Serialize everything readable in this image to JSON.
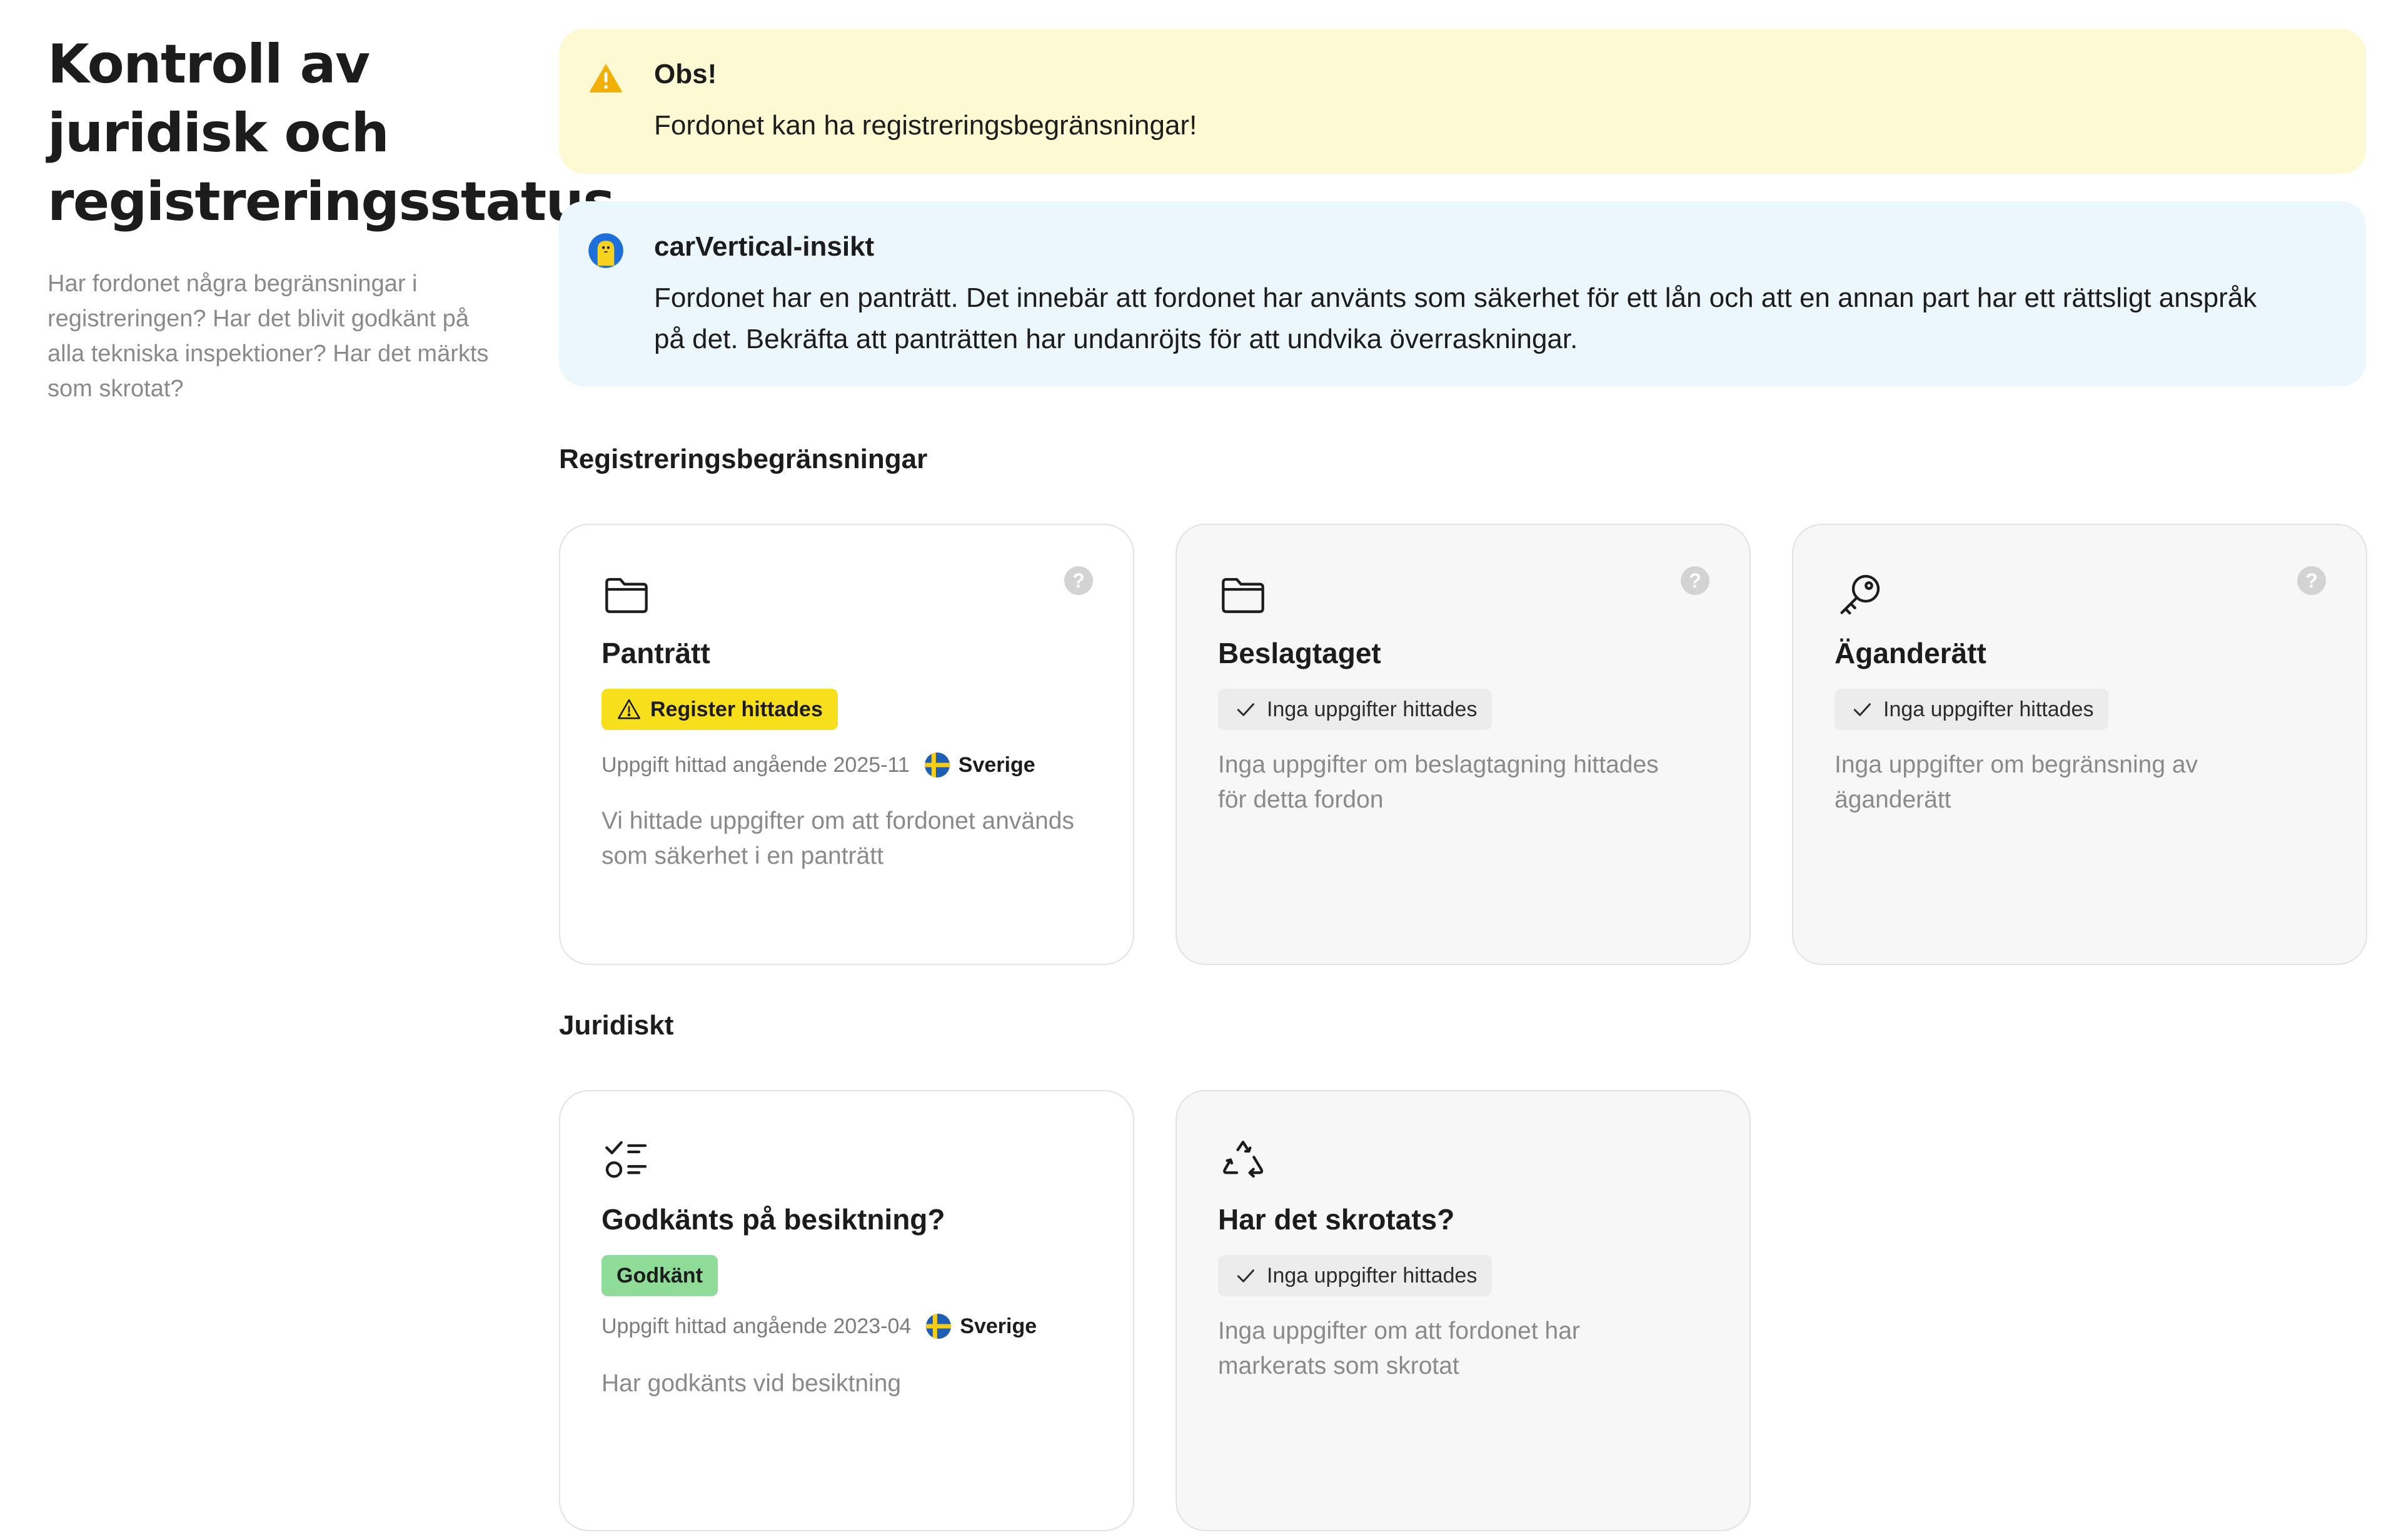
{
  "header": {
    "title": "Kontroll av juridisk och registreringsstatus",
    "description": "Har fordonet några begränsningar i registreringen? Har det blivit godkänt på alla tekniska inspektioner? Har det märkts som skrotat?"
  },
  "alerts": {
    "warning": {
      "title": "Obs!",
      "body": "Fordonet kan ha registreringsbegränsningar!",
      "icon": "warning-triangle-icon",
      "color": "#fdf9d2"
    },
    "insight": {
      "title": "carVertical-insikt",
      "body": "Fordonet har en panträtt. Det innebär att fordonet har använts som säkerhet för ett lån och att en annan part har ett rättsligt anspråk på det. Bekräfta att panträtten har undanröjts för att undvika överraskningar.",
      "icon": "carvertical-mascot-icon",
      "color": "#ecf6fd"
    }
  },
  "sections": {
    "registration": {
      "title": "Registreringsbegränsningar",
      "cards": {
        "pledge": {
          "icon": "folder-icon",
          "title": "Panträtt",
          "badge": "Register hittades",
          "badge_color": "#f8df1c",
          "meta": "Uppgift hittad angående 2025-11",
          "country": "Sverige",
          "description": "Vi hittade uppgifter om att fordonet används som säkerhet i en panträtt"
        },
        "seized": {
          "icon": "folder-icon",
          "title": "Beslagtaget",
          "badge": "Inga uppgifter hittades",
          "description": "Inga uppgifter om beslagtagning hittades för detta fordon"
        },
        "ownership": {
          "icon": "key-icon",
          "title": "Äganderätt",
          "badge": "Inga uppgifter hittades",
          "description": "Inga uppgifter om begränsning av äganderätt"
        }
      }
    },
    "legal": {
      "title": "Juridiskt",
      "cards": {
        "inspection": {
          "icon": "checklist-icon",
          "title": "Godkänts på besiktning?",
          "badge": "Godkänt",
          "badge_color": "#8edc98",
          "meta": "Uppgift hittad angående 2023-04",
          "country": "Sverige",
          "description": "Har godkänts vid besiktning"
        },
        "scrapped": {
          "icon": "recycle-icon",
          "title": "Har det skrotats?",
          "badge": "Inga uppgifter hittades",
          "description": "Inga uppgifter om att fordonet har markerats som skrotat"
        }
      }
    }
  },
  "help_label": "?"
}
